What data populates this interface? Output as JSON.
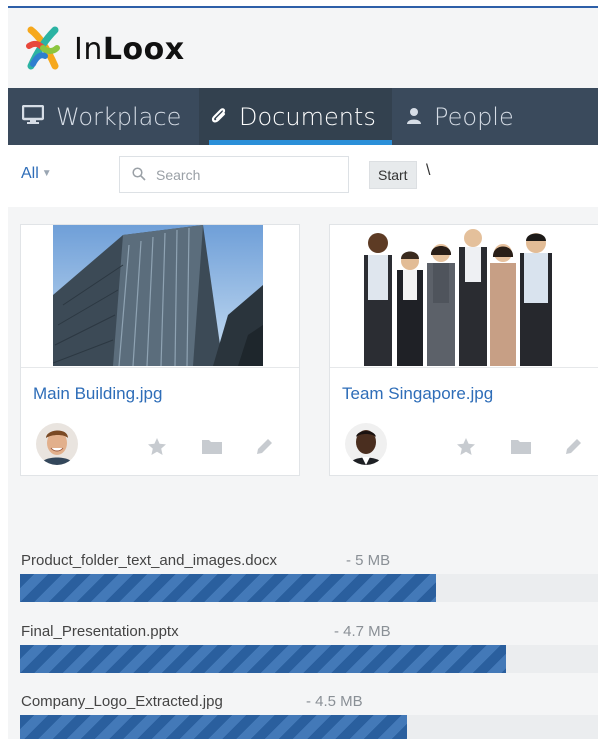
{
  "app": {
    "brand_light": "In",
    "brand_bold": "Loox"
  },
  "nav": {
    "items": [
      {
        "label": "Workplace",
        "icon": "monitor-icon"
      },
      {
        "label": "Documents",
        "icon": "paperclip-icon",
        "active": true
      },
      {
        "label": "People",
        "icon": "person-icon"
      }
    ]
  },
  "toolbar": {
    "filter_label": "All",
    "search_placeholder": "Search",
    "breadcrumb_start": "Start",
    "breadcrumb_separator": "\\"
  },
  "documents": [
    {
      "title": "Main Building.jpg",
      "thumbnail": "office-tower-photo",
      "owner_avatar": "man-smiling-avatar"
    },
    {
      "title": "Team Singapore.jpg",
      "thumbnail": "business-team-photo",
      "owner_avatar": "man-dark-avatar"
    }
  ],
  "uploads": [
    {
      "name": "Product_folder_text_and_images.docx",
      "size": "- 5 MB",
      "progress": 0.72
    },
    {
      "name": "Final_Presentation.pptx",
      "size": "- 4.7 MB",
      "progress": 0.84
    },
    {
      "name": "Company_Logo_Extracted.jpg",
      "size": "- 4.5 MB",
      "progress": 0.67
    }
  ],
  "colors": {
    "accent": "#2b8fd8",
    "nav_background": "#3a4a5c",
    "link": "#2e6db8",
    "progress": "#2a5f9e"
  }
}
